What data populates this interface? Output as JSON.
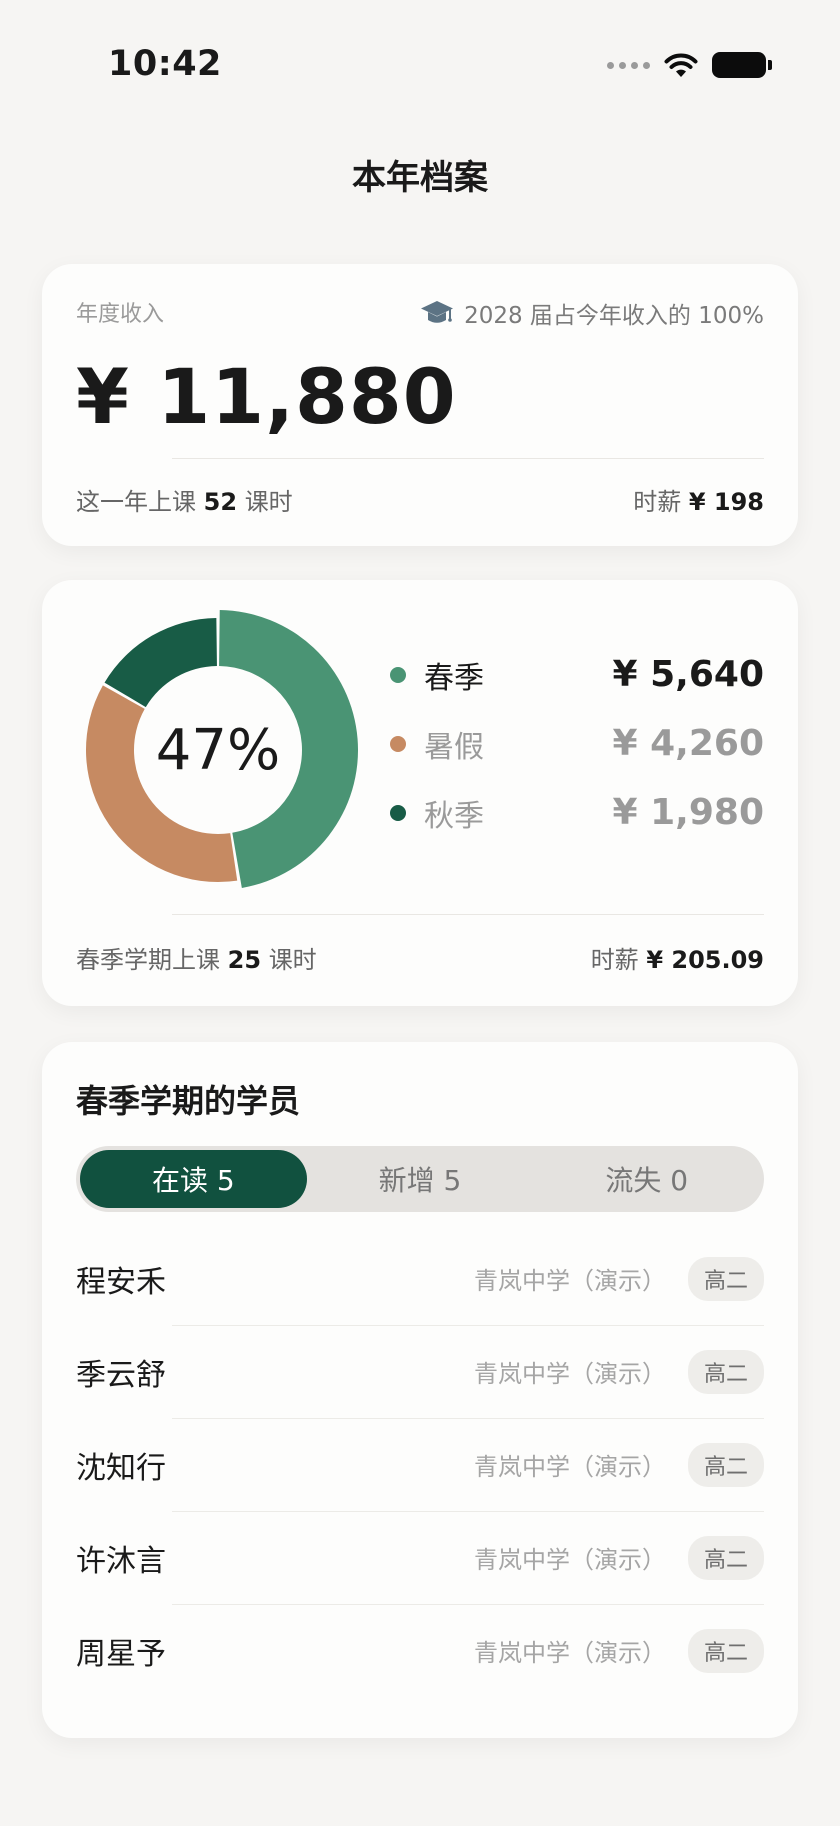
{
  "status_bar": {
    "time": "10:42"
  },
  "page_title": "本年档案",
  "income": {
    "label": "年度收入",
    "note": "2028 届占今年收入的 100%",
    "amount": "¥ 11,880",
    "lessons_prefix": "这一年上课",
    "lessons_count": "52",
    "lessons_suffix": "课时",
    "rate_prefix": "时薪",
    "rate_value": "¥ 198"
  },
  "seasons": {
    "center_label": "47%",
    "items": [
      {
        "name": "春季",
        "value": "¥ 5,640",
        "amount": 5640,
        "color": "#4a9474",
        "active": true
      },
      {
        "name": "暑假",
        "value": "¥ 4,260",
        "amount": 4260,
        "color": "#c68a62",
        "active": false
      },
      {
        "name": "秋季",
        "value": "¥ 1,980",
        "amount": 1980,
        "color": "#185c46",
        "active": false
      }
    ],
    "footer_left_prefix": "春季学期上课",
    "footer_left_count": "25",
    "footer_left_suffix": "课时",
    "footer_right_prefix": "时薪",
    "footer_right_value": "¥ 205.09"
  },
  "students": {
    "title": "春季学期的学员",
    "tabs": [
      {
        "label": "在读 5",
        "active": true
      },
      {
        "label": "新增 5",
        "active": false
      },
      {
        "label": "流失 0",
        "active": false
      }
    ],
    "list": [
      {
        "name": "程安禾",
        "school": "青岚中学（演示）",
        "grade": "高二"
      },
      {
        "name": "季云舒",
        "school": "青岚中学（演示）",
        "grade": "高二"
      },
      {
        "name": "沈知行",
        "school": "青岚中学（演示）",
        "grade": "高二"
      },
      {
        "name": "许沐言",
        "school": "青岚中学（演示）",
        "grade": "高二"
      },
      {
        "name": "周星予",
        "school": "青岚中学（演示）",
        "grade": "高二"
      }
    ]
  }
}
